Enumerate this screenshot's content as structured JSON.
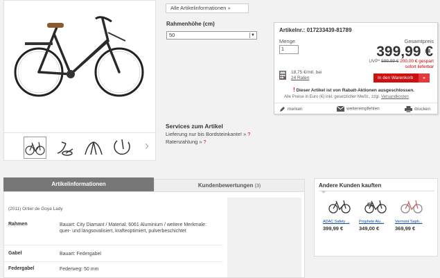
{
  "gallery": {
    "thumbnails": [
      "bike-thumb-1",
      "bike-thumb-2",
      "bike-thumb-3",
      "bike-thumb-4"
    ],
    "next_icon": "chevron-right-icon"
  },
  "top": {
    "all_info_button": "Alle Artikelinformationen »"
  },
  "frame_size": {
    "label": "Rahmenhöhe (cm)",
    "selected": "50"
  },
  "buybox": {
    "article_number": "Artikelnr.: 017233439-81789",
    "quantity_label": "Menge",
    "quantity_value": "1",
    "total_label": "Gesamtpreis",
    "price": "399,99 €",
    "uvp_prefix": "UVP*",
    "uvp_value": "599,99 €",
    "saving": "200,00 € gespart",
    "availability": "sofort lieferbar",
    "rate_text": "18,75 €/mtl. bei",
    "rate_link": "24 Raten",
    "cart_button": "In den Warenkorb",
    "cart_chevron": "»",
    "warning_mark": "!",
    "warning": "Dieser Artikel ist von Rabatt-Aktionen ausgeschlossen.",
    "fine_print": "Alle Preise in Euro (€) inkl. gesetzlicher MwSt., zzgl.",
    "fine_link": "Versandkosten",
    "actions": {
      "remember": "merken",
      "recommend": "weiterempfehlen",
      "print": "drucken"
    }
  },
  "services": {
    "title": "Services zum Artikel",
    "items": [
      {
        "text": "Lieferung nur bis Bordsteinkante! »",
        "mark": "?"
      },
      {
        "text": "Ratenzahlung »",
        "mark": "?"
      }
    ]
  },
  "tabs": {
    "active": "Artikelinformationen",
    "inactive": "Kundenbewertungen",
    "review_count": "(3)"
  },
  "info": {
    "subtitle": "(2011) Ortler de Goya Lady",
    "specs": [
      {
        "key": "Rahmen",
        "value": "Bauart: City Diamant / Material: 6061 Aluminium / weitere Merkmale: quer- und längsovalisiert, krafteoptimiert, pulverbeschichtet"
      },
      {
        "key": "Gabel",
        "value": "Bauart: Federgabel"
      },
      {
        "key": "Federgabel",
        "value": "Federweg: 50 mm"
      }
    ]
  },
  "also_bought": {
    "title": "Andere Kunden kauften",
    "products": [
      {
        "name": "ADAC Safety ...",
        "price": "399,99 €"
      },
      {
        "name": "Prophete Alu...",
        "price": "349,00 €"
      },
      {
        "name": "Vermont Saph...",
        "price": "369,99 €"
      }
    ]
  },
  "colors": {
    "accent_red": "#cc1111",
    "tab_grey": "#777777"
  }
}
